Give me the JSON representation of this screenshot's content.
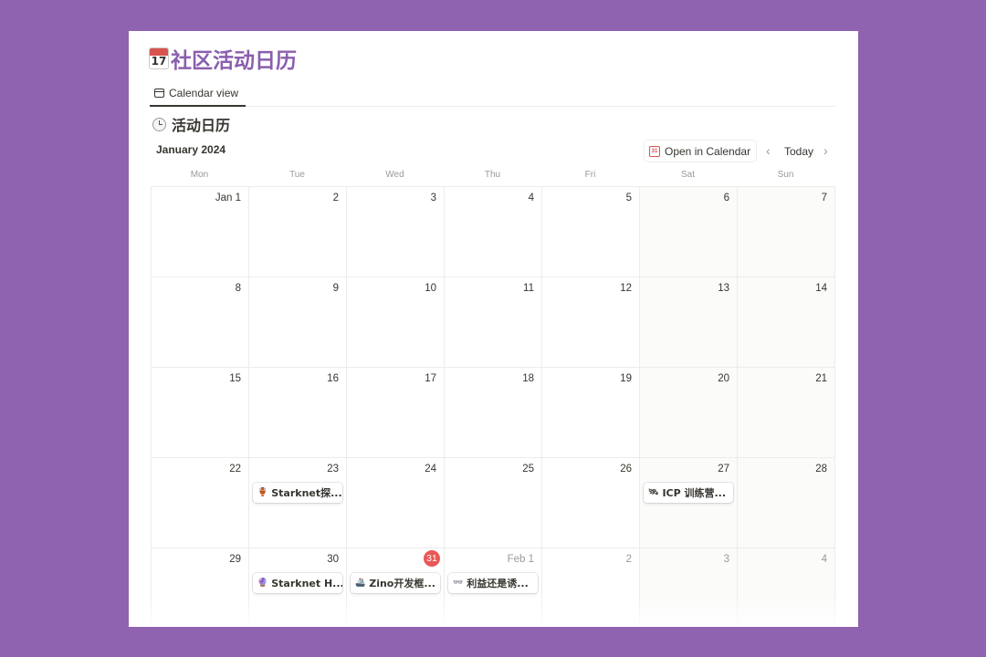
{
  "page": {
    "title": "社区活动日历",
    "title_icon_text": "17",
    "title_icon": "calendar-icon"
  },
  "tabs": [
    {
      "label": "Calendar view",
      "icon": "calendar-view-icon",
      "active": true
    }
  ],
  "view": {
    "title": "活动日历",
    "icon": "clock-icon"
  },
  "toolbar": {
    "month_label": "January 2024",
    "open_in_calendar_label": "Open in Calendar",
    "calendar_icon_text": "31",
    "today_label": "Today",
    "prev_icon": "chevron-left-icon",
    "next_icon": "chevron-right-icon"
  },
  "weekdays": [
    "Mon",
    "Tue",
    "Wed",
    "Thu",
    "Fri",
    "Sat",
    "Sun"
  ],
  "weeks": [
    [
      {
        "label": "Jan 1"
      },
      {
        "label": "2"
      },
      {
        "label": "3"
      },
      {
        "label": "4"
      },
      {
        "label": "5"
      },
      {
        "label": "6"
      },
      {
        "label": "7"
      }
    ],
    [
      {
        "label": "8"
      },
      {
        "label": "9"
      },
      {
        "label": "10"
      },
      {
        "label": "11"
      },
      {
        "label": "12"
      },
      {
        "label": "13"
      },
      {
        "label": "14"
      }
    ],
    [
      {
        "label": "15"
      },
      {
        "label": "16"
      },
      {
        "label": "17"
      },
      {
        "label": "18"
      },
      {
        "label": "19"
      },
      {
        "label": "20"
      },
      {
        "label": "21"
      }
    ],
    [
      {
        "label": "22"
      },
      {
        "label": "23",
        "event": {
          "icon": "🏺",
          "title": "Starknet探..."
        }
      },
      {
        "label": "24"
      },
      {
        "label": "25"
      },
      {
        "label": "26"
      },
      {
        "label": "27",
        "event": {
          "icon": "🛰",
          "title": "ICP 训练营..."
        }
      },
      {
        "label": "28"
      }
    ],
    [
      {
        "label": "29"
      },
      {
        "label": "30",
        "event": {
          "icon": "🔮",
          "title": "Starknet H..."
        }
      },
      {
        "label": "31",
        "today": true,
        "event": {
          "icon": "🚢",
          "title": "Zino开发框..."
        }
      },
      {
        "label": "Feb 1",
        "muted": true,
        "event": {
          "icon": "👓",
          "title": "利益还是诱..."
        }
      },
      {
        "label": "2",
        "muted": true
      },
      {
        "label": "3",
        "muted": true
      },
      {
        "label": "4",
        "muted": true
      }
    ]
  ],
  "colors": {
    "background": "#8f63b0",
    "title": "#8a5fae",
    "today_badge": "#eb5757"
  }
}
